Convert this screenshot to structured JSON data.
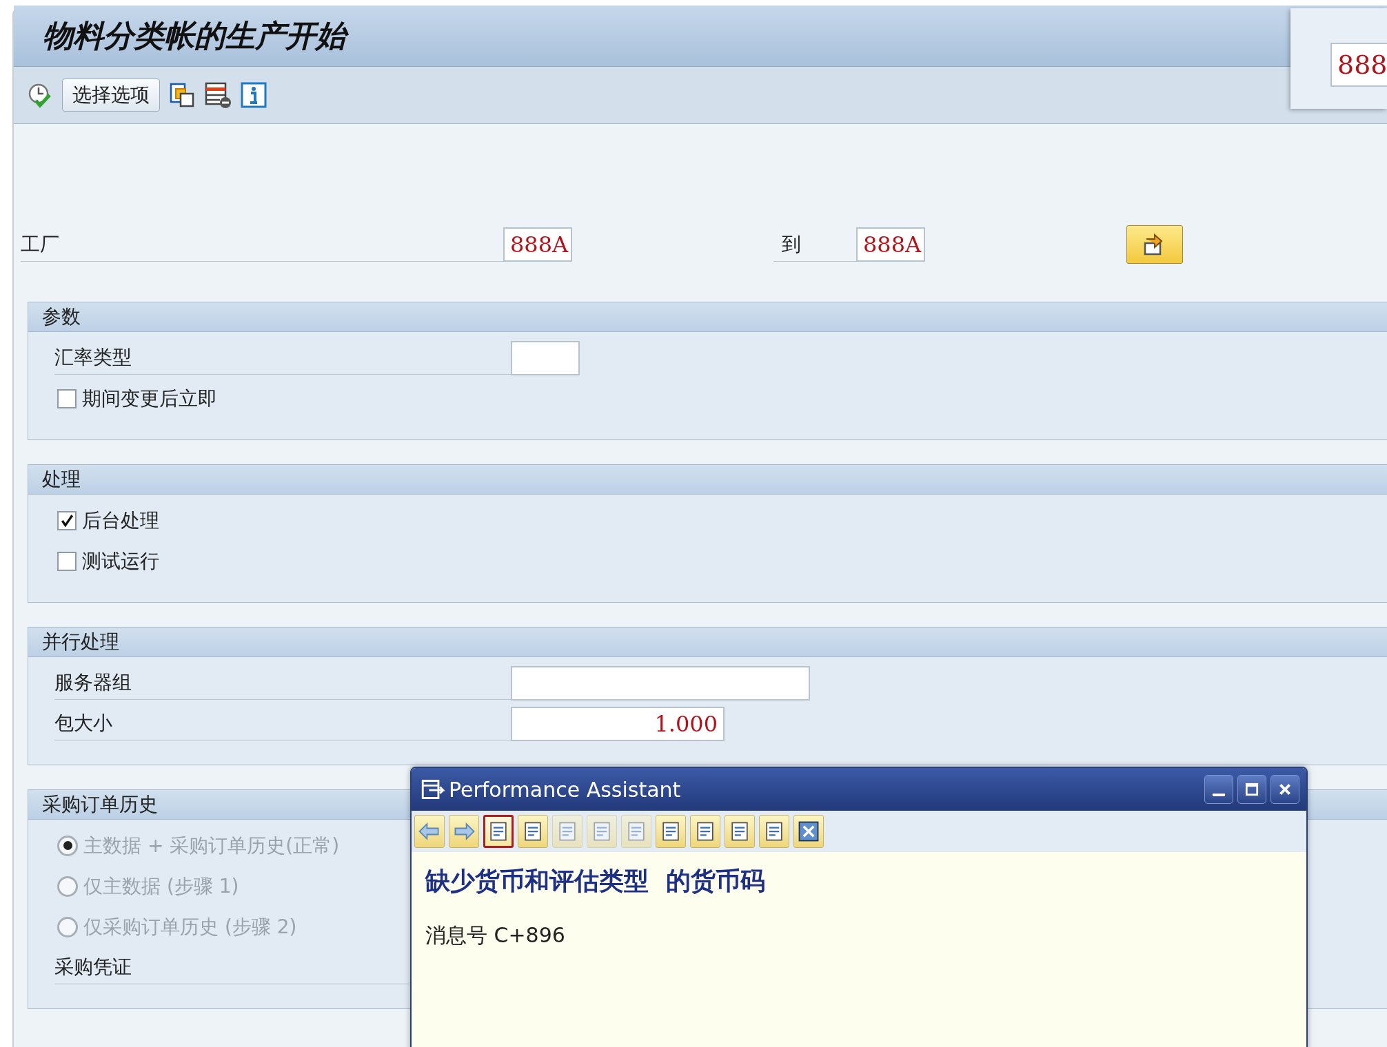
{
  "window": {
    "title": "物料分类帐的生产开始"
  },
  "toolbar": {
    "button": "选择选项"
  },
  "corner_popup": {
    "value": "888"
  },
  "plant": {
    "label": "工厂",
    "from": "888A",
    "to_label": "到",
    "to": "888A"
  },
  "groups": [
    {
      "title": "参数",
      "items": [
        {
          "kind": "field",
          "label": "汇率类型",
          "value": ""
        },
        {
          "kind": "checkbox",
          "label": "期间变更后立即",
          "checked": false
        }
      ]
    },
    {
      "title": "处理",
      "items": [
        {
          "kind": "checkbox",
          "label": "后台处理",
          "checked": true
        },
        {
          "kind": "checkbox",
          "label": "测试运行",
          "checked": false
        }
      ]
    },
    {
      "title": "并行处理",
      "items": [
        {
          "kind": "field",
          "label": "服务器组",
          "value": ""
        },
        {
          "kind": "field",
          "label": "包大小",
          "value": "1.000"
        }
      ]
    },
    {
      "title": "采购订单历史",
      "items": [
        {
          "kind": "radio",
          "label": "主数据 + 采购订单历史(正常)",
          "selected": true,
          "disabled": true
        },
        {
          "kind": "radio",
          "label": "仅主数据 (步骤 1)",
          "selected": false,
          "disabled": true
        },
        {
          "kind": "radio",
          "label": "仅采购订单历史 (步骤 2)",
          "selected": false,
          "disabled": true
        },
        {
          "kind": "label",
          "label": "采购凭证"
        }
      ]
    }
  ],
  "assistant": {
    "title": "Performance Assistant",
    "tools": [
      {
        "selected": false,
        "disabled": false
      },
      {
        "selected": false,
        "disabled": false
      },
      {
        "selected": true,
        "disabled": false
      },
      {
        "selected": false,
        "disabled": false
      },
      {
        "selected": false,
        "disabled": true
      },
      {
        "selected": false,
        "disabled": true
      },
      {
        "selected": false,
        "disabled": true
      },
      {
        "selected": false,
        "disabled": false
      },
      {
        "selected": false,
        "disabled": false
      },
      {
        "selected": false,
        "disabled": false
      },
      {
        "selected": false,
        "disabled": false
      },
      {
        "selected": false,
        "disabled": false
      }
    ],
    "heading": "缺少货币和评估类型  的货币码",
    "message": "消息号 C+896"
  }
}
